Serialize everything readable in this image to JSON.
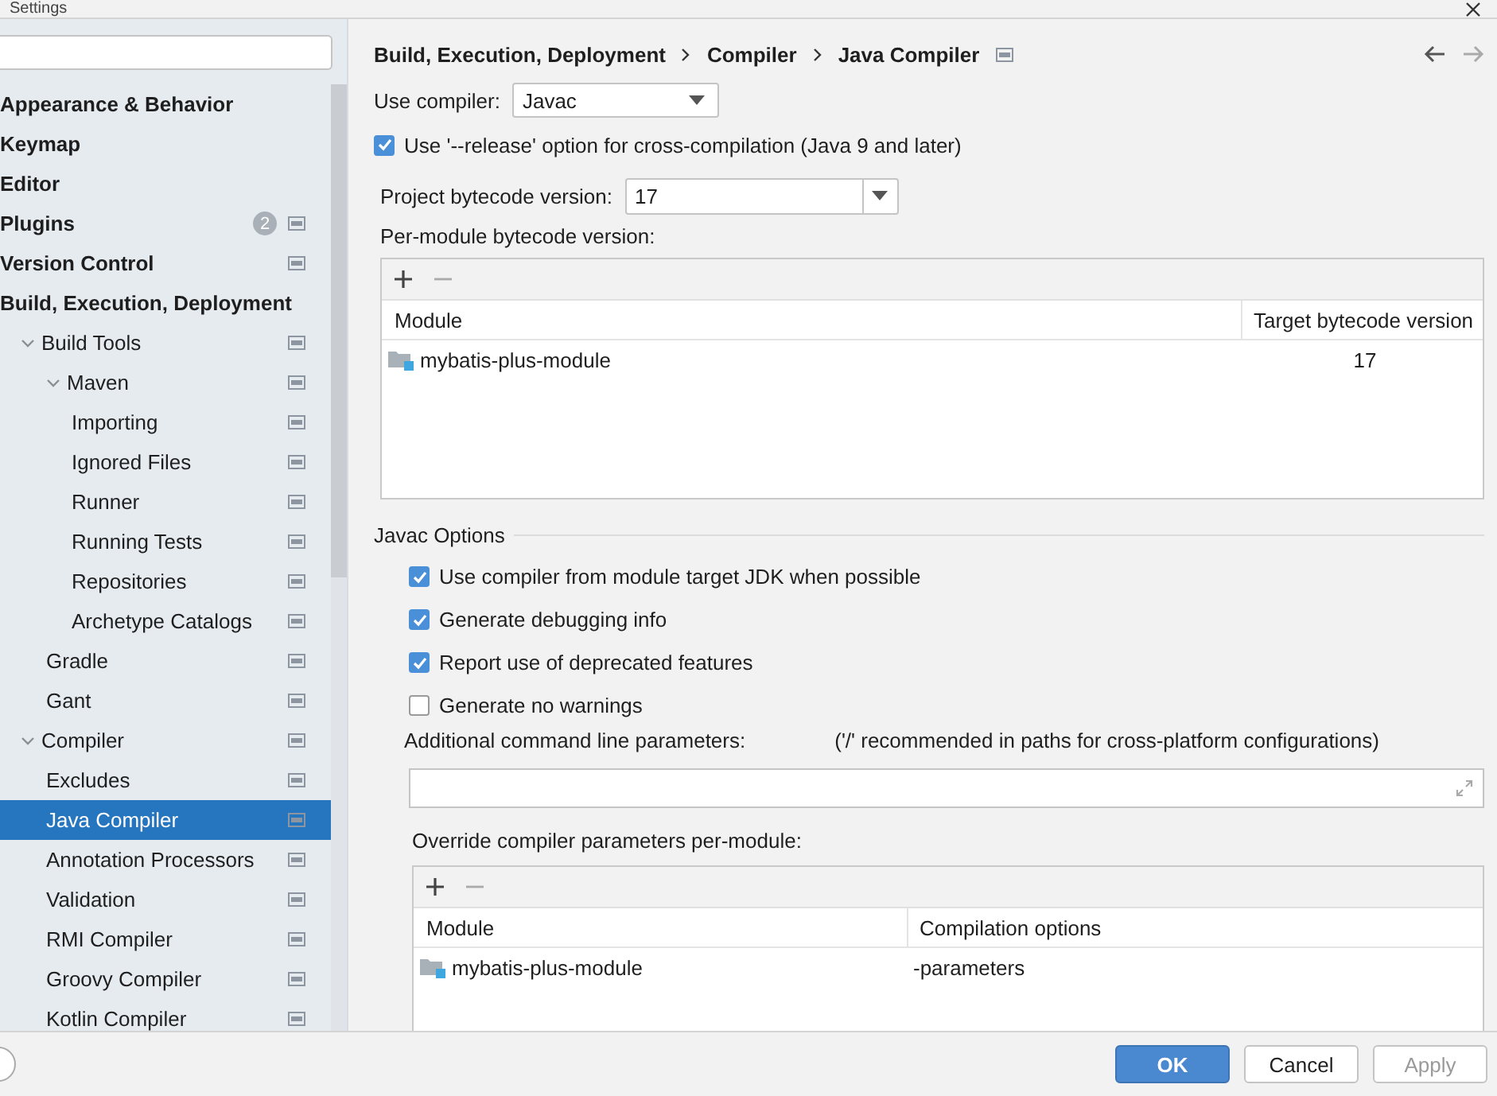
{
  "window": {
    "title": "Settings"
  },
  "sidebar": {
    "items": [
      {
        "label": "Appearance & Behavior",
        "selected": false,
        "has_settings_icon": false
      },
      {
        "label": "Keymap",
        "selected": false,
        "has_settings_icon": false
      },
      {
        "label": "Editor",
        "selected": false,
        "has_settings_icon": false
      },
      {
        "label": "Plugins",
        "selected": false,
        "has_settings_icon": true,
        "badge": "2"
      },
      {
        "label": "Version Control",
        "selected": false,
        "has_settings_icon": true
      },
      {
        "label": "Build, Execution, Deployment",
        "selected": false,
        "has_settings_icon": false,
        "children": [
          {
            "label": "Build Tools",
            "selected": false,
            "expanded": true,
            "has_settings_icon": true,
            "children": [
              {
                "label": "Maven",
                "selected": false,
                "expanded": true,
                "has_settings_icon": true,
                "children": [
                  {
                    "label": "Importing",
                    "selected": false,
                    "has_settings_icon": true
                  },
                  {
                    "label": "Ignored Files",
                    "selected": false,
                    "has_settings_icon": true
                  },
                  {
                    "label": "Runner",
                    "selected": false,
                    "has_settings_icon": true
                  },
                  {
                    "label": "Running Tests",
                    "selected": false,
                    "has_settings_icon": true
                  },
                  {
                    "label": "Repositories",
                    "selected": false,
                    "has_settings_icon": true
                  },
                  {
                    "label": "Archetype Catalogs",
                    "selected": false,
                    "has_settings_icon": true
                  }
                ]
              },
              {
                "label": "Gradle",
                "selected": false,
                "has_settings_icon": true
              },
              {
                "label": "Gant",
                "selected": false,
                "has_settings_icon": true
              }
            ]
          },
          {
            "label": "Compiler",
            "selected": false,
            "expanded": true,
            "has_settings_icon": true,
            "children": [
              {
                "label": "Excludes",
                "selected": false,
                "has_settings_icon": true
              },
              {
                "label": "Java Compiler",
                "selected": true,
                "has_settings_icon": true
              },
              {
                "label": "Annotation Processors",
                "selected": false,
                "has_settings_icon": true
              },
              {
                "label": "Validation",
                "selected": false,
                "has_settings_icon": true
              },
              {
                "label": "RMI Compiler",
                "selected": false,
                "has_settings_icon": true
              },
              {
                "label": "Groovy Compiler",
                "selected": false,
                "has_settings_icon": true
              },
              {
                "label": "Kotlin Compiler",
                "selected": false,
                "has_settings_icon": true
              }
            ]
          }
        ]
      }
    ]
  },
  "breadcrumb": [
    "Build, Execution, Deployment",
    "Compiler",
    "Java Compiler"
  ],
  "use_compiler": {
    "label": "Use compiler:",
    "value": "Javac"
  },
  "release_option": {
    "label": "Use '--release' option for cross-compilation (Java 9 and later)",
    "checked": true
  },
  "project_bytecode": {
    "label": "Project bytecode version:",
    "value": "17"
  },
  "per_module": {
    "label": "Per-module bytecode version:",
    "columns": [
      "Module",
      "Target bytecode version"
    ],
    "rows": [
      {
        "module": "mybatis-plus-module",
        "version": "17"
      }
    ]
  },
  "javac_options": {
    "title": "Javac Options",
    "checkboxes": [
      {
        "label": "Use compiler from module target JDK when possible",
        "checked": true
      },
      {
        "label": "Generate debugging info",
        "checked": true
      },
      {
        "label": "Report use of deprecated features",
        "checked": true
      },
      {
        "label": "Generate no warnings",
        "checked": false
      }
    ],
    "additional_params": {
      "label": "Additional command line parameters:",
      "hint": "('/' recommended in paths for cross-platform configurations)"
    },
    "override": {
      "label": "Override compiler parameters per-module:",
      "columns": [
        "Module",
        "Compilation options"
      ],
      "rows": [
        {
          "module": "mybatis-plus-module",
          "options": "-parameters"
        }
      ]
    }
  },
  "buttons": [
    {
      "label": "OK",
      "kind": "primary",
      "disabled": false
    },
    {
      "label": "Cancel",
      "kind": "normal",
      "disabled": false
    },
    {
      "label": "Apply",
      "kind": "normal",
      "disabled": true
    }
  ]
}
